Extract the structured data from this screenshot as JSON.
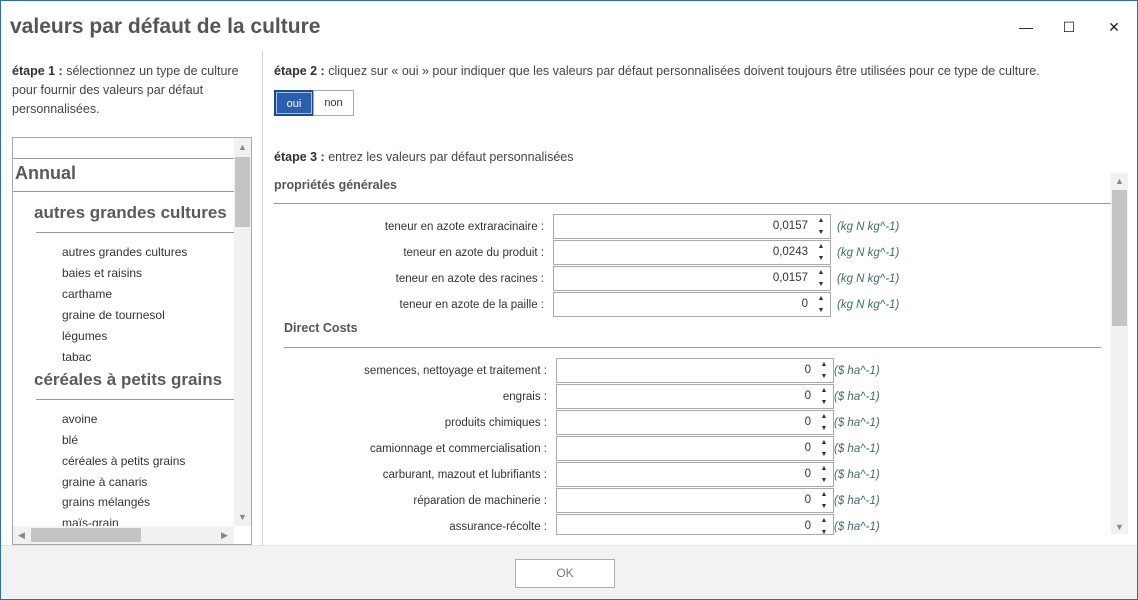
{
  "window": {
    "title": "valeurs par défaut de la culture",
    "minimize_icon": "—",
    "maximize_icon": "☐",
    "close_icon": "✕"
  },
  "step1": {
    "label": "étape 1 :",
    "text": " sélectionnez un type de culture pour fournir des valeurs par défaut personnalisées."
  },
  "tree": {
    "group": "Annual",
    "categories": [
      {
        "label": "autres grandes cultures",
        "items": [
          "autres grandes cultures",
          "baies et raisins",
          "carthame",
          "graine de tournesol",
          "légumes",
          "tabac"
        ]
      },
      {
        "label": "céréales à petits grains",
        "items": [
          "avoine",
          "blé",
          "céréales à petits grains",
          "graine à canaris",
          "grains mélangés",
          "maïs-grain"
        ]
      }
    ]
  },
  "step2": {
    "label": "étape 2 :",
    "text": " cliquez sur « oui » pour indiquer que les valeurs par défaut personnalisées doivent toujours être utilisées pour ce type de culture.",
    "oui": "oui",
    "non": "non",
    "selected": "oui"
  },
  "step3": {
    "label": "étape 3 :",
    "text": " entrez les valeurs par défaut personnalisées"
  },
  "general": {
    "title": "propriétés générales",
    "fields": [
      {
        "label": "teneur en azote extraracinaire :",
        "value": "0,0157",
        "unit": "(kg N kg^-1)"
      },
      {
        "label": "teneur en azote du produit :",
        "value": "0,0243",
        "unit": "(kg N kg^-1)"
      },
      {
        "label": "teneur en azote des racines :",
        "value": "0,0157",
        "unit": "(kg N kg^-1)"
      },
      {
        "label": "teneur en azote de la paille :",
        "value": "0",
        "unit": "(kg N kg^-1)"
      }
    ]
  },
  "costs": {
    "title": "Direct Costs",
    "fields": [
      {
        "label": "semences, nettoyage et traitement :",
        "value": "0",
        "unit": "($ ha^-1)"
      },
      {
        "label": "engrais :",
        "value": "0",
        "unit": "($ ha^-1)"
      },
      {
        "label": "produits chimiques :",
        "value": "0",
        "unit": "($ ha^-1)"
      },
      {
        "label": "camionnage et commercialisation :",
        "value": "0",
        "unit": "($ ha^-1)"
      },
      {
        "label": "carburant, mazout et lubrifiants :",
        "value": "0",
        "unit": "($ ha^-1)"
      },
      {
        "label": "réparation de machinerie :",
        "value": "0",
        "unit": "($ ha^-1)"
      },
      {
        "label": "assurance-récolte :",
        "value": "0",
        "unit": "($ ha^-1)"
      }
    ]
  },
  "footer": {
    "ok": "OK"
  }
}
